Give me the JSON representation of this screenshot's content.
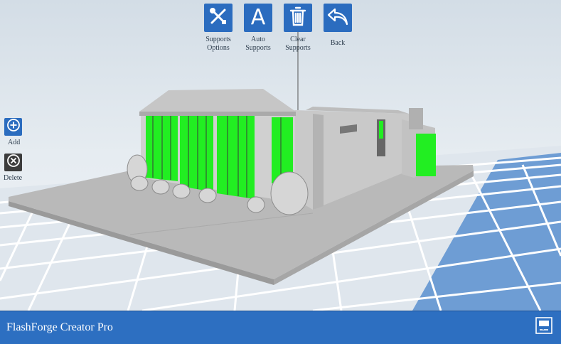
{
  "toolbar": {
    "supports_options": "Supports\nOptions",
    "auto_supports": "Auto\nSupports",
    "clear_supports": "Clear\nSupports",
    "back": "Back",
    "supports_options_icon": "tools-icon",
    "auto_supports_icon": "letter-a-icon",
    "clear_supports_icon": "trash-icon",
    "back_icon": "undo-arrow-icon"
  },
  "side": {
    "add": "Add",
    "delete": "Delete",
    "add_icon": "plus-circle-icon",
    "delete_icon": "x-circle-icon"
  },
  "footer": {
    "printer_name": "FlashForge Creator Pro",
    "printer_icon": "printer-icon"
  },
  "colors": {
    "accent": "#2d6fc1",
    "support_green": "#22ee22",
    "model_gray": "#c4c4c4",
    "grid_bg": "#e2e9f0"
  }
}
